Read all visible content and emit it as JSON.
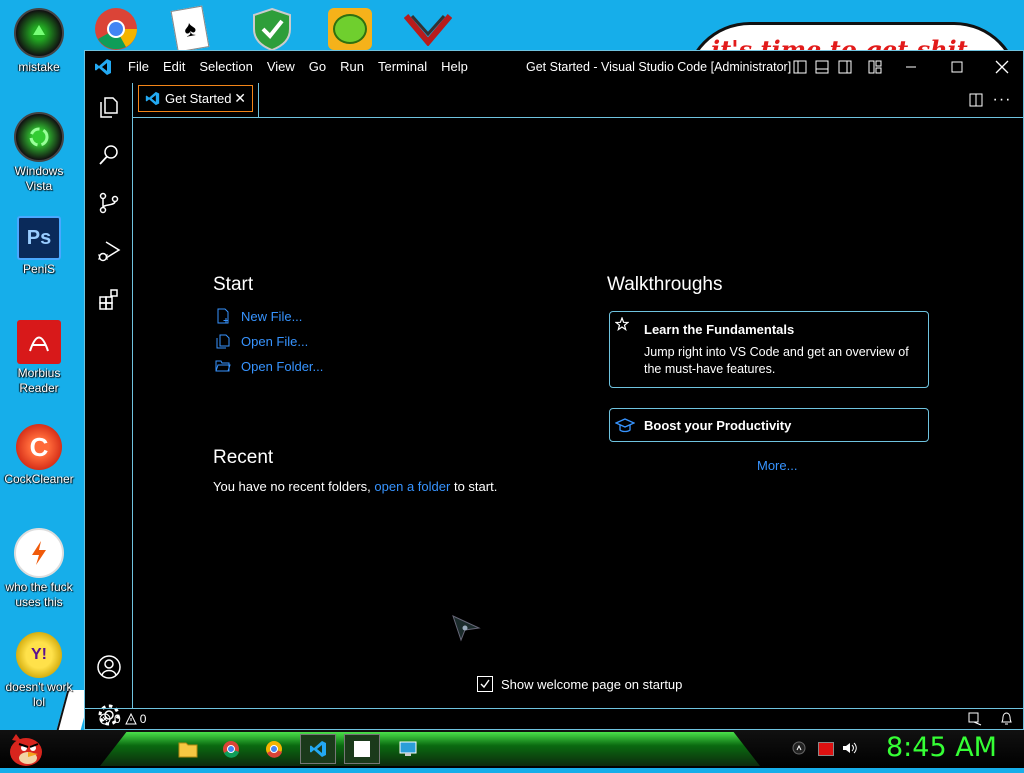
{
  "desktop": {
    "icons": [
      {
        "label": "mistake",
        "icon": "green-orb-icon"
      },
      {
        "label": "Windows Vista",
        "icon": "recycle-orb-icon"
      },
      {
        "label": "PeniS",
        "icon": "photoshop-icon"
      },
      {
        "label": "Morbius Reader",
        "icon": "pdf-reader-icon"
      },
      {
        "label": "CockCleaner",
        "icon": "ccleaner-icon"
      },
      {
        "label": "who the fuck uses this",
        "icon": "lightning-icon"
      },
      {
        "label": "doesn't work lol",
        "icon": "yahoo-messenger-icon"
      }
    ],
    "top_icons": [
      "chrome-icon",
      "solitaire-icon",
      "shield-icon",
      "angry-birds-pig-icon",
      "ultrakill-icon"
    ],
    "wallpaper_text": "it's time to get shit"
  },
  "window": {
    "title": "Get Started - Visual Studio Code [Administrator]",
    "menu": [
      "File",
      "Edit",
      "Selection",
      "View",
      "Go",
      "Run",
      "Terminal",
      "Help"
    ]
  },
  "tab": {
    "label": "Get Started"
  },
  "start": {
    "heading": "Start",
    "links": [
      {
        "label": "New File...",
        "icon": "new-file-icon"
      },
      {
        "label": "Open File...",
        "icon": "open-file-icon"
      },
      {
        "label": "Open Folder...",
        "icon": "open-folder-icon"
      }
    ]
  },
  "recent": {
    "heading": "Recent",
    "text_before": "You have no recent folders,",
    "link": "open a folder",
    "text_after": "to start."
  },
  "walkthroughs": {
    "heading": "Walkthroughs",
    "cards": [
      {
        "title": "Learn the Fundamentals",
        "description": "Jump right into VS Code and get an overview of the must-have features."
      },
      {
        "title": "Boost your Productivity"
      }
    ],
    "more": "More..."
  },
  "startup": {
    "label": "Show welcome page on startup",
    "checked": true
  },
  "status": {
    "errors": "0",
    "warnings": "0"
  },
  "taskbar": {
    "clock": "8:45 AM"
  },
  "colors": {
    "accent_border": "#6fc3df",
    "tab_border": "#f38518",
    "link": "#3794ff",
    "desktop": "#16aeea",
    "clock": "#35ff35"
  }
}
